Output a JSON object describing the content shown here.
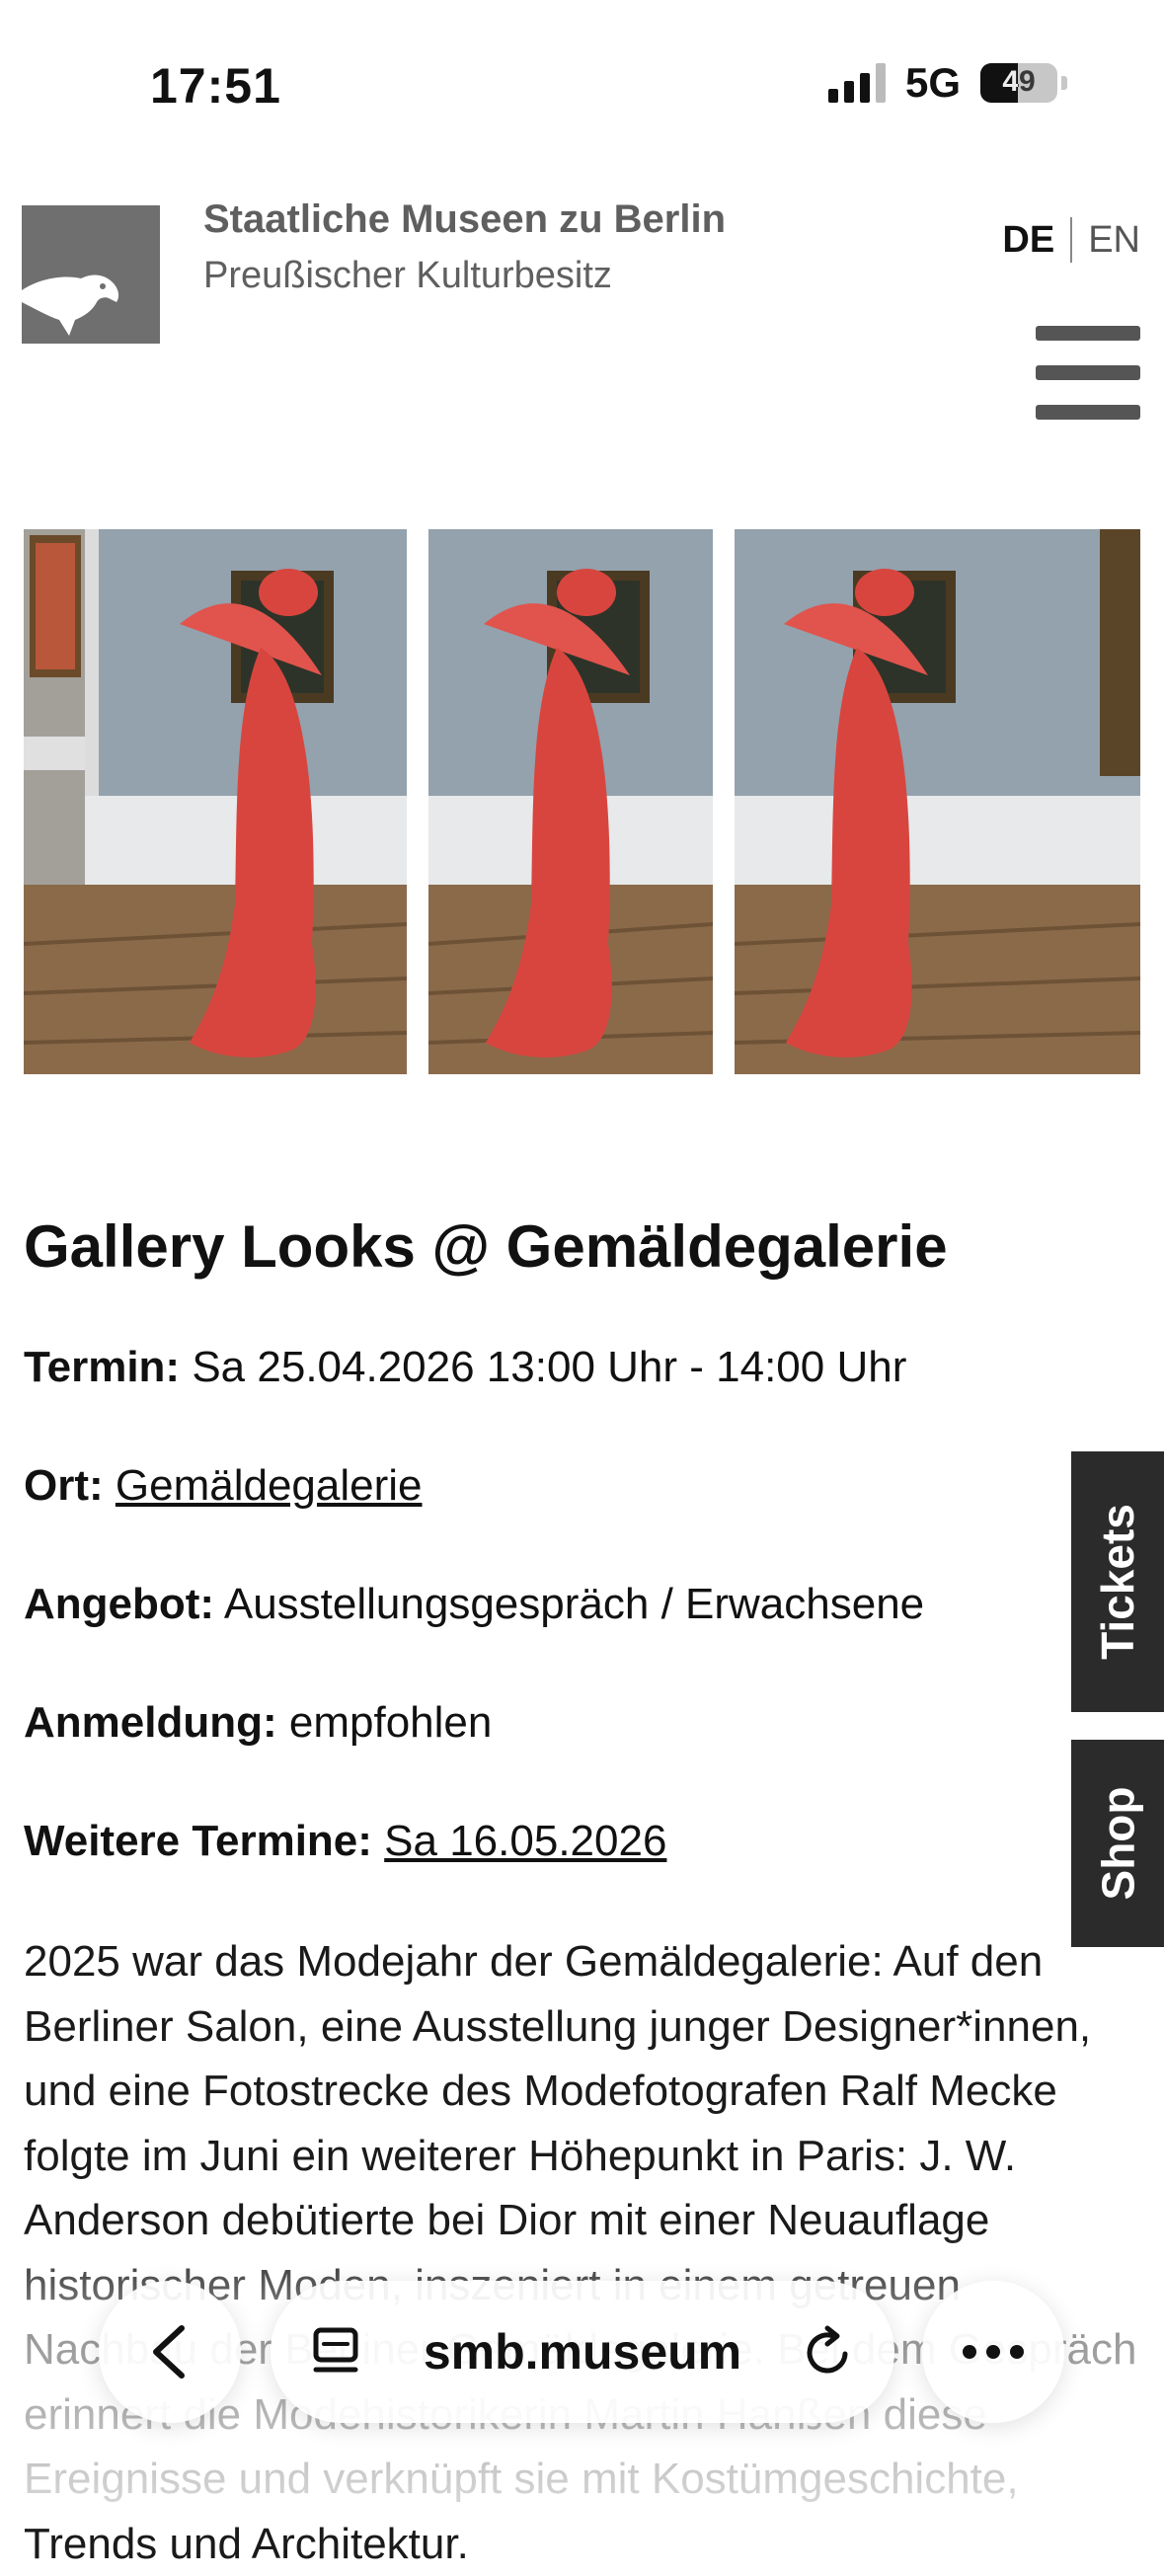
{
  "status_bar": {
    "time": "17:51",
    "network": "5G",
    "battery": "49"
  },
  "header": {
    "org_name": "Staatliche Museen zu Berlin",
    "org_sub": "Preußischer Kulturbesitz",
    "lang_de": "DE",
    "lang_en": "EN"
  },
  "event": {
    "title": "Gallery Looks @ Gemäldegalerie",
    "termin_label": "Termin:",
    "termin_value": "Sa 25.04.2026 13:00 Uhr - 14:00 Uhr",
    "ort_label": "Ort:",
    "ort_value": "Gemäldegalerie",
    "angebot_label": "Angebot:",
    "angebot_value": "Ausstellungsgespräch / Erwachsene",
    "anmeldung_label": "Anmeldung:",
    "anmeldung_value": "empfohlen",
    "weitere_label": "Weitere Termine:",
    "weitere_value": "Sa 16.05.2026",
    "description": "2025 war das Modejahr der Gemäldegalerie: Auf den Berliner Salon, eine Ausstellung junger Designer*innen, und eine Fotostrecke des Modefotografen Ralf Mecke folgte im Juni ein weiterer Höhepunkt in Paris: J. W. Anderson debütierte bei Dior mit einer Neuauflage historischer Moden, inszeniert in einem getreuen Nachbau der Berliner Gemäldegalerie. Bei dem Gespräch erinnert die Modehistorikerin Martin Hanßen diese Ereignisse und verknüpft sie mit Kostümgeschichte, Trends und Architektur."
  },
  "side_tabs": {
    "tickets": "Tickets",
    "shop": "Shop"
  },
  "browser": {
    "url": "smb.museum"
  },
  "colors": {
    "accent_dark": "#2b2b2b",
    "logo_gray": "#6f6f6f",
    "figure_red": "#d8453f"
  }
}
